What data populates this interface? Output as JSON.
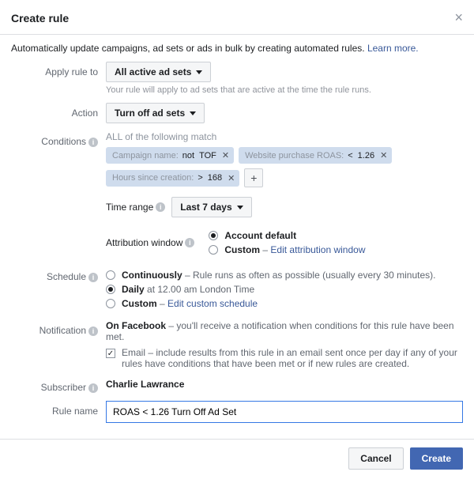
{
  "header": {
    "title": "Create rule"
  },
  "subtitle": {
    "text": "Automatically update campaigns, ad sets or ads in bulk by creating automated rules.",
    "link": "Learn more."
  },
  "labels": {
    "apply_to": "Apply rule to",
    "action": "Action",
    "conditions": "Conditions",
    "schedule": "Schedule",
    "notification": "Notification",
    "subscriber": "Subscriber",
    "rule_name": "Rule name",
    "time_range": "Time range",
    "attribution": "Attribution window"
  },
  "apply_to": {
    "selected": "All active ad sets",
    "hint": "Your rule will apply to ad sets that are active at the time the rule runs."
  },
  "action": {
    "selected": "Turn off ad sets"
  },
  "conditions": {
    "header": "ALL of the following match",
    "pills": [
      {
        "field": "Campaign name:",
        "op": "not",
        "val": "TOF"
      },
      {
        "field": "Website purchase ROAS:",
        "op": "<",
        "val": "1.26"
      },
      {
        "field": "Hours since creation:",
        "op": ">",
        "val": "168"
      }
    ],
    "time_range_selected": "Last 7 days"
  },
  "attribution": {
    "options": {
      "default": "Account default",
      "custom": "Custom",
      "custom_link": "Edit attribution window"
    },
    "selected": "default"
  },
  "schedule": {
    "options": {
      "continuous": "Continuously",
      "continuous_desc": " – Rule runs as often as possible (usually every 30 minutes).",
      "daily": "Daily",
      "daily_desc": " at 12.00 am London Time",
      "custom": "Custom",
      "custom_link": "Edit custom schedule"
    },
    "selected": "daily"
  },
  "notification": {
    "text_bold": "On Facebook",
    "text_rest": " – you'll receive a notification when conditions for this rule have been met.",
    "email_label": "Email",
    "email_desc": " – include results from this rule in an email sent once per day if any of your rules have conditions that have been met or if new rules are created.",
    "email_checked": true
  },
  "subscriber": {
    "name": "Charlie Lawrance"
  },
  "rule_name": {
    "value": "ROAS < 1.26 Turn Off Ad Set"
  },
  "footer": {
    "cancel": "Cancel",
    "create": "Create"
  }
}
